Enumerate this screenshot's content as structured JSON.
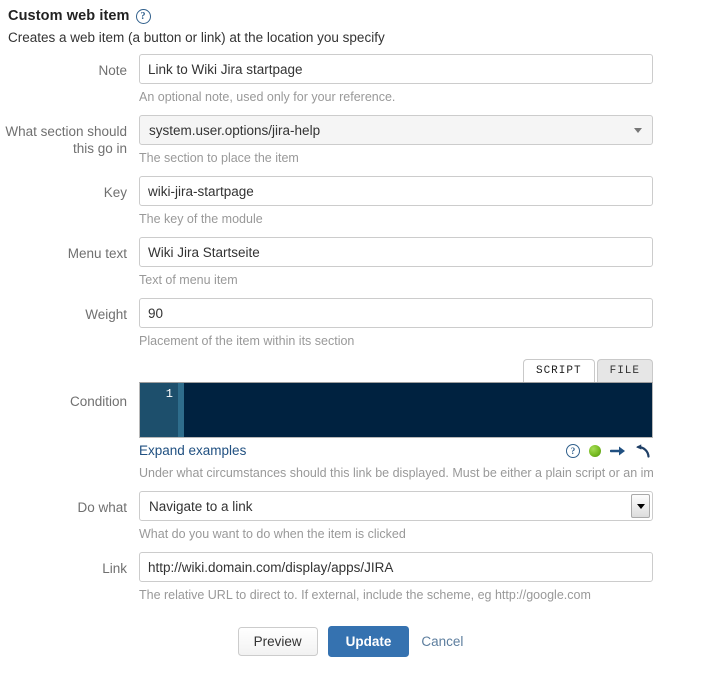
{
  "header": {
    "title": "Custom web item",
    "help_icon": "help-circle-icon",
    "description": "Creates a web item (a button or link) at the location you specify"
  },
  "fields": {
    "note": {
      "label": "Note",
      "value": "Link to Wiki Jira startpage",
      "description": "An optional note, used only for your reference."
    },
    "section": {
      "label": "What section should this go in",
      "label_line1": "What section should",
      "label_line2": "this go in",
      "value": "system.user.options/jira-help",
      "description": "The section to place the item"
    },
    "key": {
      "label": "Key",
      "value": "wiki-jira-startpage",
      "description": "The key of the module"
    },
    "menu_text": {
      "label": "Menu text",
      "value": "Wiki Jira Startseite",
      "description": "Text of menu item"
    },
    "weight": {
      "label": "Weight",
      "value": "90",
      "description": "Placement of the item within its section"
    },
    "condition": {
      "label": "Condition",
      "tabs": [
        {
          "label": "SCRIPT",
          "active": true
        },
        {
          "label": "FILE",
          "active": false
        }
      ],
      "line_number": "1",
      "code": "",
      "expand_link": "Expand examples",
      "icons": [
        "help-circle-icon",
        "status-green-icon",
        "arrow-right-icon",
        "undo-arrow-icon"
      ],
      "description": "Under what circumstances should this link be displayed. Must be either a plain script or an implemen"
    },
    "do_what": {
      "label": "Do what",
      "value": "Navigate to a link",
      "description": "What do you want to do when the item is clicked"
    },
    "link": {
      "label": "Link",
      "value": "http://wiki.domain.com/display/apps/JIRA",
      "description": "The relative URL to direct to. If external, include the scheme, eg http://google.com"
    }
  },
  "actions": {
    "preview": "Preview",
    "update": "Update",
    "cancel": "Cancel"
  },
  "colors": {
    "primary_button": "#3572b0",
    "link": "#205081",
    "editor_background": "#002240",
    "editor_gutter": "#1d4f6c",
    "status_green": "#77bb22"
  }
}
